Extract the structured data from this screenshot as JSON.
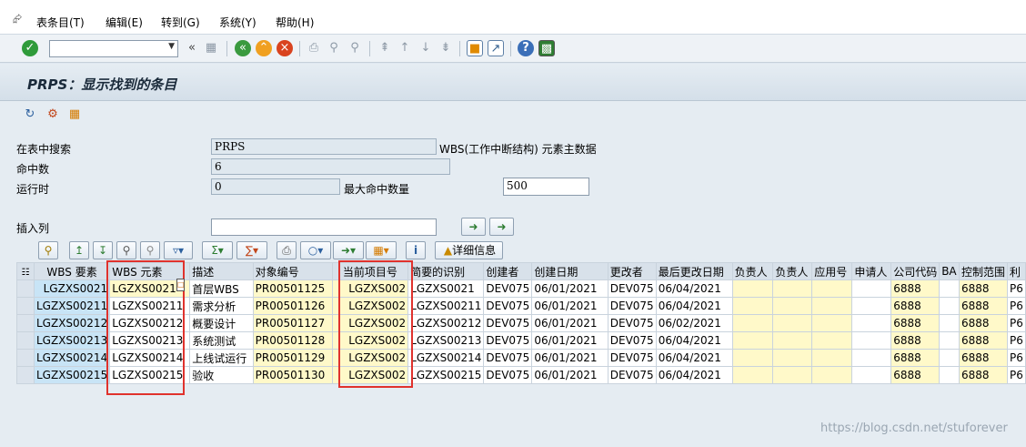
{
  "menu": {
    "items": [
      "表条目(T)",
      "编辑(E)",
      "转到(G)",
      "系统(Y)",
      "帮助(H)"
    ]
  },
  "toolbar": {
    "command_value": "",
    "icons": [
      "confirm-icon",
      "dropdown-icon",
      "back-arrows-icon",
      "save-icon",
      "back-icon",
      "exit-icon",
      "cancel-icon",
      "print-icon",
      "find-icon",
      "find-next-icon",
      "first-page-icon",
      "prev-page-icon",
      "next-page-icon",
      "last-page-icon",
      "create-session-icon",
      "shortcut-icon",
      "help-icon",
      "layout-icon"
    ]
  },
  "title": "PRPS：显示找到的条目",
  "search": {
    "table_label": "在表中搜索",
    "table_value": "PRPS",
    "table_desc": "WBS(工作中断结构) 元素主数据",
    "hits_label": "命中数",
    "hits_value": "6",
    "runtime_label": "运行时",
    "runtime_value": "0",
    "max_hits_label": "最大命中数量",
    "max_hits_value": "500",
    "insert_col_label": "插入列",
    "insert_col_value": ""
  },
  "grid_toolbar": {
    "details_label": "详细信息"
  },
  "table": {
    "columns": [
      "WBS 要素",
      "WBS 元素",
      "描述",
      "对象编号",
      "当前项目号",
      "简要的识别",
      "创建者",
      "创建日期",
      "更改者",
      "最后更改日期",
      "负责人",
      "负责人",
      "应用号",
      "申请人",
      "公司代码",
      "BA",
      "控制范围",
      "利"
    ],
    "rows": [
      [
        "LGZXS0021",
        "LGZXS0021",
        "首层WBS",
        "PR00501125",
        "LGZXS002",
        "LGZXS0021",
        "DEV075",
        "06/01/2021",
        "DEV075",
        "06/04/2021",
        "",
        "",
        "",
        "",
        "6888",
        "",
        "6888",
        "P6"
      ],
      [
        "LGZXS00211",
        "LGZXS00211",
        "需求分析",
        "PR00501126",
        "LGZXS002",
        "LGZXS00211",
        "DEV075",
        "06/01/2021",
        "DEV075",
        "06/04/2021",
        "",
        "",
        "",
        "",
        "6888",
        "",
        "6888",
        "P6"
      ],
      [
        "LGZXS00212",
        "LGZXS00212",
        "概要设计",
        "PR00501127",
        "LGZXS002",
        "LGZXS00212",
        "DEV075",
        "06/01/2021",
        "DEV075",
        "06/02/2021",
        "",
        "",
        "",
        "",
        "6888",
        "",
        "6888",
        "P6"
      ],
      [
        "LGZXS00213",
        "LGZXS00213",
        "系统测试",
        "PR00501128",
        "LGZXS002",
        "LGZXS00213",
        "DEV075",
        "06/01/2021",
        "DEV075",
        "06/04/2021",
        "",
        "",
        "",
        "",
        "6888",
        "",
        "6888",
        "P6"
      ],
      [
        "LGZXS00214",
        "LGZXS00214",
        "上线试运行",
        "PR00501129",
        "LGZXS002",
        "LGZXS00214",
        "DEV075",
        "06/01/2021",
        "DEV075",
        "06/04/2021",
        "",
        "",
        "",
        "",
        "6888",
        "",
        "6888",
        "P6"
      ],
      [
        "LGZXS00215",
        "LGZXS00215",
        "验收",
        "PR00501130",
        "LGZXS002",
        "LGZXS00215",
        "DEV075",
        "06/01/2021",
        "DEV075",
        "06/04/2021",
        "",
        "",
        "",
        "",
        "6888",
        "",
        "6888",
        "P6"
      ]
    ]
  },
  "colors": {
    "highlight_box": "#e0322d",
    "key_cell": "#c8e4f6",
    "input_cell": "#fff9c9"
  },
  "watermark": "https://blog.csdn.net/stuforever"
}
